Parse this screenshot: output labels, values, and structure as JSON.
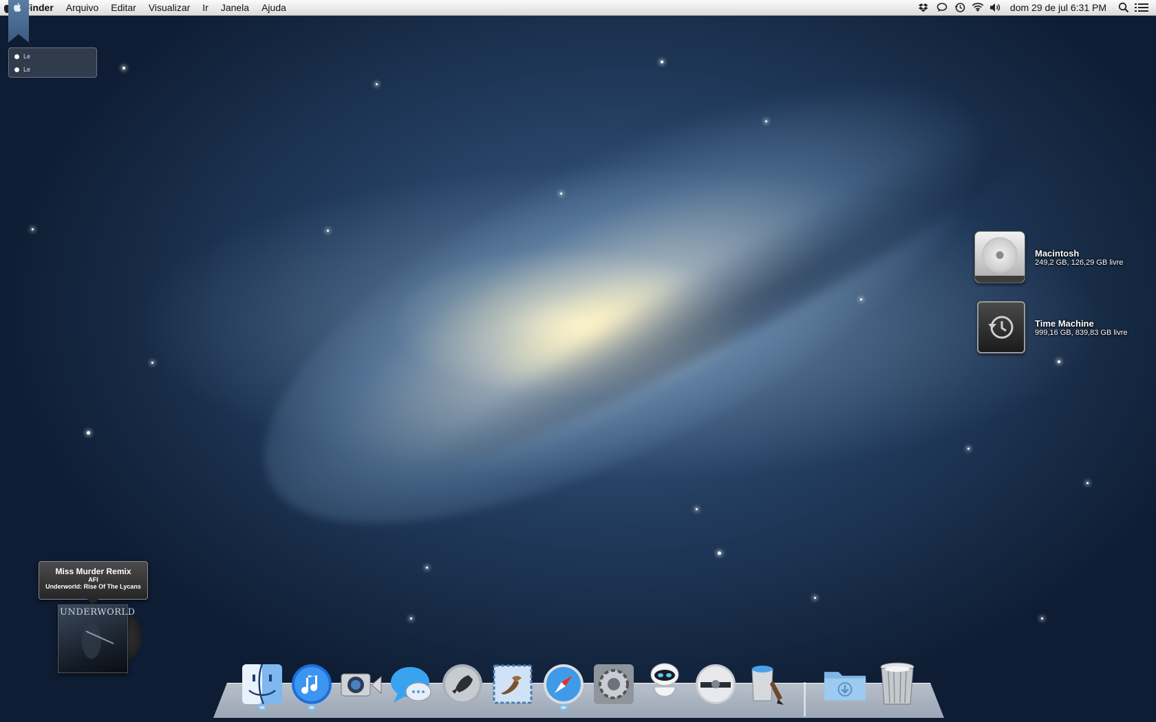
{
  "menubar": {
    "apple_icon": "apple-logo-icon",
    "items": [
      "Finder",
      "Arquivo",
      "Editar",
      "Visualizar",
      "Ir",
      "Janela",
      "Ajuda"
    ],
    "tray_icons": [
      "dropbox-icon",
      "chat-bubble-icon",
      "time-machine-clock-icon",
      "wifi-icon",
      "volume-icon"
    ],
    "clock": "dom 29 de jul  6:31 PM",
    "spotlight_icon": "spotlight-search-icon",
    "notification_icon": "notification-center-icon"
  },
  "notes_widget": {
    "items": [
      "Le",
      "Le"
    ]
  },
  "desktop": {
    "items": [
      {
        "name": "Macintosh",
        "info": "249,2 GB, 126,29 GB livre",
        "icon": "hard-drive-icon"
      },
      {
        "name": "Time Machine",
        "info": "999,16 GB, 839,83 GB livre",
        "icon": "time-machine-drive-icon"
      }
    ]
  },
  "now_playing": {
    "title": "Miss Murder Remix",
    "artist": "AFI",
    "album": "Underworld: Rise Of The Lycans",
    "cover_text": "UNDERWORLD"
  },
  "dock": {
    "items": [
      {
        "name": "finder",
        "icon": "finder-icon"
      },
      {
        "name": "itunes",
        "icon": "itunes-icon"
      },
      {
        "name": "facetime",
        "icon": "facetime-icon"
      },
      {
        "name": "messages",
        "icon": "messages-icon"
      },
      {
        "name": "launchpad",
        "icon": "launchpad-icon"
      },
      {
        "name": "mail",
        "icon": "mail-icon"
      },
      {
        "name": "safari",
        "icon": "safari-icon"
      },
      {
        "name": "system-preferences",
        "icon": "gear-icon"
      },
      {
        "name": "eve-robot",
        "icon": "eve-robot-icon"
      },
      {
        "name": "dvd-player",
        "icon": "dvd-disc-icon"
      },
      {
        "name": "paint-bucket",
        "icon": "paint-bucket-icon"
      },
      {
        "name": "downloads",
        "icon": "downloads-folder-icon"
      },
      {
        "name": "trash",
        "icon": "trash-icon"
      }
    ]
  }
}
